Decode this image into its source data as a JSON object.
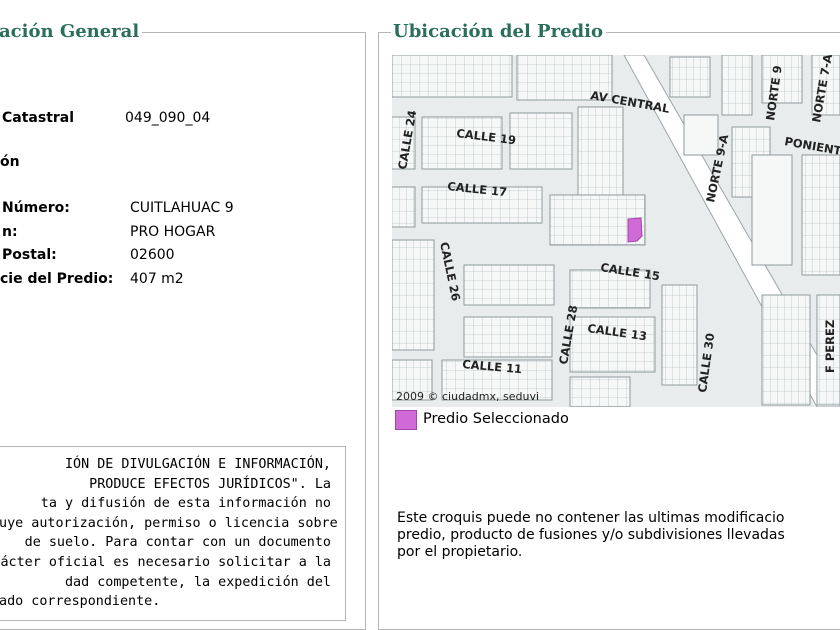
{
  "general": {
    "legend": "ación General",
    "cuenta_label": "Catastral",
    "cuenta_value": "049_090_04",
    "section_label": "ón",
    "calle_label": "Número:",
    "calle_value": "CUITLAHUAC 9",
    "colonia_label": "n:",
    "colonia_value": "PRO HOGAR",
    "cp_label": "Postal:",
    "cp_value": "02600",
    "superficie_label": "cie del Predio:",
    "superficie_value": "407 m2",
    "disclaimer_lines": [
      "IÓN DE DIVULGACIÓN E INFORMACIÓN,",
      "PRODUCE EFECTOS JURÍDICOS\". La",
      "ta y difusión de esta información no",
      "tuye autorización, permiso o licencia sobre",
      "de suelo. Para contar con un documento",
      "rácter oficial es necesario solicitar a la",
      "dad competente, la expedición del",
      "cado correspondiente."
    ]
  },
  "location": {
    "legend": "Ubicación del Predio",
    "copyright": "2009 © ciudadmx, seduvi",
    "legend_label": "Predio Seleccionado",
    "legend_color": "#d06ad6",
    "note_lines": [
      "Este croquis puede no contener las ultimas modificacio",
      "predio, producto de fusiones y/o subdivisiones llevadas",
      "por el propietario."
    ],
    "map_labels": {
      "av_central": "AV CENTRAL",
      "calle19": "CALLE 19",
      "calle24": "CALLE 24",
      "calle17": "CALLE 17",
      "calle26": "CALLE 26",
      "calle15": "CALLE 15",
      "calle28": "CALLE 28",
      "calle13": "CALLE 13",
      "calle30": "CALLE 30",
      "calle11": "CALLE 11",
      "norte9a": "NORTE 9-A",
      "norte9": "NORTE 9",
      "norte7a": "NORTE 7-A",
      "poniente": "PONIENT",
      "fperez": "F PEREZ"
    }
  }
}
